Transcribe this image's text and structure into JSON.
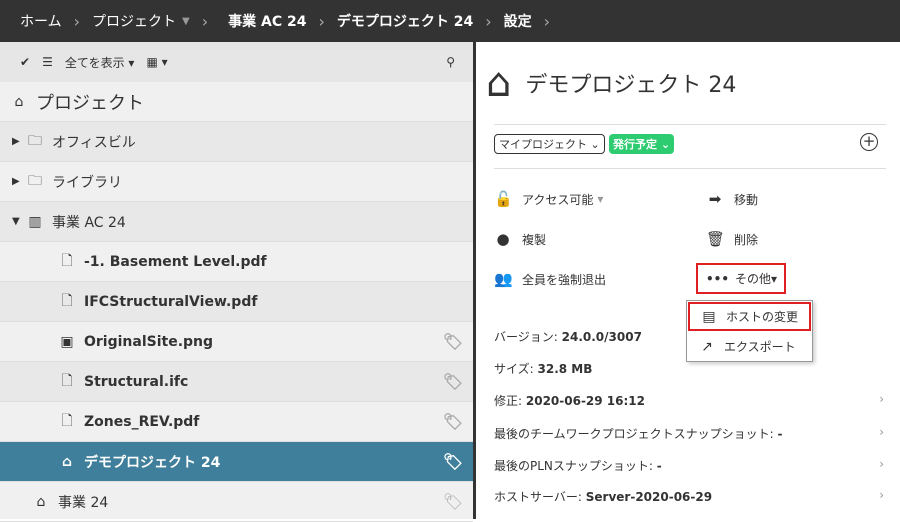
{
  "breadcrumb": {
    "home": "ホーム",
    "projects": "プロジェクト",
    "business": "事業 AC 24",
    "demo": "デモプロジェクト 24",
    "settings": "設定"
  },
  "toolbar": {
    "show_all": "全てを表示"
  },
  "tree": {
    "header": "プロジェクト",
    "items": [
      {
        "label": "オフィスビル"
      },
      {
        "label": "ライブラリ"
      },
      {
        "label": "事業 AC 24"
      },
      {
        "label": "-1. Basement Level.pdf"
      },
      {
        "label": "IFCStructuralView.pdf"
      },
      {
        "label": "OriginalSite.png"
      },
      {
        "label": "Structural.ifc"
      },
      {
        "label": "Zones_REV.pdf"
      },
      {
        "label": "デモプロジェクト 24"
      },
      {
        "label": "事業 24"
      }
    ]
  },
  "detail": {
    "title": "デモプロジェクト 24",
    "my_project": "マイプロジェクト",
    "status": "発行予定",
    "actions": {
      "access": "アクセス可能",
      "move": "移動",
      "duplicate": "複製",
      "delete": "削除",
      "kick": "全員を強制退出",
      "more": "その他"
    },
    "menu": {
      "change_host": "ホストの変更",
      "export": "エクスポート"
    },
    "info": {
      "version_label": "バージョン:",
      "version": "24.0.0/3007",
      "size_label": "サイズ:",
      "size": "32.8 MB",
      "modified_label": "修正:",
      "modified": "2020-06-29 16:12",
      "teamwork_label": "最後のチームワークプロジェクトスナップショット:",
      "teamwork": "-",
      "pln_label": "最後のPLNスナップショット:",
      "pln": "-",
      "host_label": "ホストサーバー:",
      "host": "Server-2020-06-29"
    }
  },
  "colors": {
    "selected": "#3f7f9b",
    "status": "#2ecc71",
    "highlight": "#e02020"
  }
}
